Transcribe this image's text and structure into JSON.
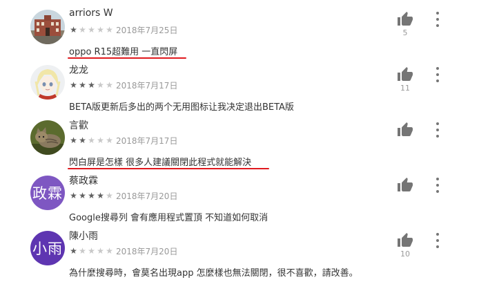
{
  "reviews": [
    {
      "author": "arriors W",
      "rating": 1,
      "date": "2018年7月25日",
      "text": "oppo R15超難用 一直閃屏",
      "likes": "5",
      "underlined": true,
      "avatar": {
        "type": "photo",
        "icon": "building-photo-icon"
      }
    },
    {
      "author": "龙龙",
      "rating": 3,
      "date": "2018年7月17日",
      "text": "BETA版更新后多出的两个无用图标让我决定退出BETA版",
      "likes": "11",
      "underlined": false,
      "avatar": {
        "type": "photo",
        "icon": "anime-character-icon"
      }
    },
    {
      "author": "言歡",
      "rating": 2,
      "date": "2018年7月17日",
      "text": "閃白屏是怎樣 很多人建議關閉此程式就能解決",
      "likes": "",
      "underlined": true,
      "avatar": {
        "type": "photo",
        "icon": "cat-photo-icon"
      }
    },
    {
      "author": "蔡政霖",
      "rating": 4,
      "date": "2018年7月20日",
      "text": "Google搜尋列 會有應用程式置頂 不知道如何取消",
      "likes": "",
      "underlined": false,
      "avatar": {
        "type": "initials",
        "label": "政霖",
        "color": "#7e57c2"
      }
    },
    {
      "author": "陳小雨",
      "rating": 1,
      "date": "2018年7月20日",
      "text": "為什麼搜尋時，會莫名出現app 怎麼樣也無法關閉，很不喜歡，請改善。",
      "likes": "10",
      "underlined": false,
      "avatar": {
        "type": "initials",
        "label": "小雨",
        "color": "#5e35b1"
      }
    }
  ],
  "colors": {
    "highlight_underline": "#e0191e",
    "star_filled": "#5f5f5f",
    "star_empty": "#c8c8c8"
  }
}
